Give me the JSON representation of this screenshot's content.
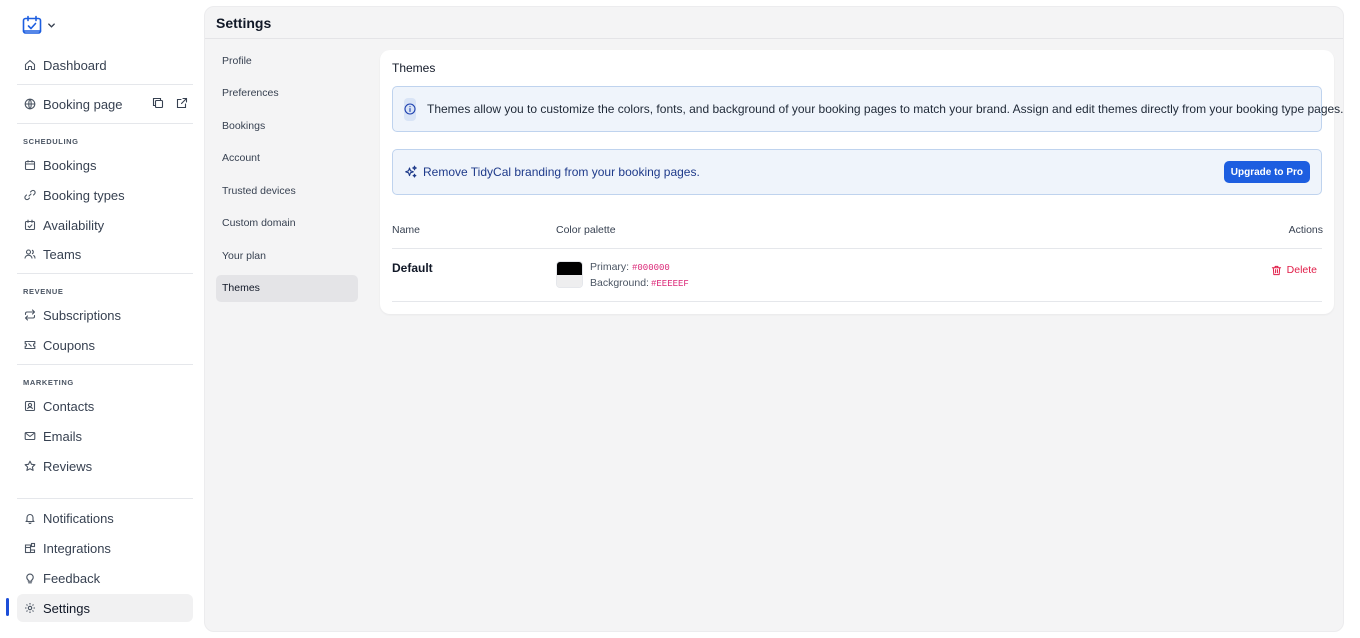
{
  "app": {
    "logo_icon": "calendar-check-icon"
  },
  "sidebar": {
    "dashboard": "Dashboard",
    "booking_page": "Booking page",
    "sections": {
      "scheduling": "SCHEDULING",
      "revenue": "REVENUE",
      "marketing": "MARKETING"
    },
    "items": {
      "bookings": "Bookings",
      "booking_types": "Booking types",
      "availability": "Availability",
      "teams": "Teams",
      "subscriptions": "Subscriptions",
      "coupons": "Coupons",
      "contacts": "Contacts",
      "emails": "Emails",
      "reviews": "Reviews",
      "notifications": "Notifications",
      "integrations": "Integrations",
      "feedback": "Feedback",
      "settings": "Settings"
    },
    "active": "Settings"
  },
  "header": {
    "title": "Settings"
  },
  "settings_nav": [
    {
      "label": "Profile"
    },
    {
      "label": "Preferences"
    },
    {
      "label": "Bookings"
    },
    {
      "label": "Account"
    },
    {
      "label": "Trusted devices"
    },
    {
      "label": "Custom domain"
    },
    {
      "label": "Your plan"
    },
    {
      "label": "Themes"
    }
  ],
  "settings_active": "Themes",
  "themes": {
    "title": "Themes",
    "info": "Themes allow you to customize the colors, fonts, and background of your booking pages to match your brand. Assign and edit themes directly from your booking type pages.",
    "promo_text": "Remove TidyCal branding from your booking pages.",
    "upgrade_label": "Upgrade to Pro",
    "columns": {
      "name": "Name",
      "palette": "Color palette",
      "actions": "Actions"
    },
    "rows": [
      {
        "name": "Default",
        "primary_label": "Primary:",
        "primary_value": "#000000",
        "background_label": "Background:",
        "background_value": "#EEEEEF",
        "delete_label": "Delete"
      }
    ]
  },
  "colors": {
    "accent": "#1D5EE0",
    "danger": "#E11D48",
    "code": "#DB2777",
    "swatch_primary": "#000000",
    "swatch_background": "#EEEEEF"
  }
}
